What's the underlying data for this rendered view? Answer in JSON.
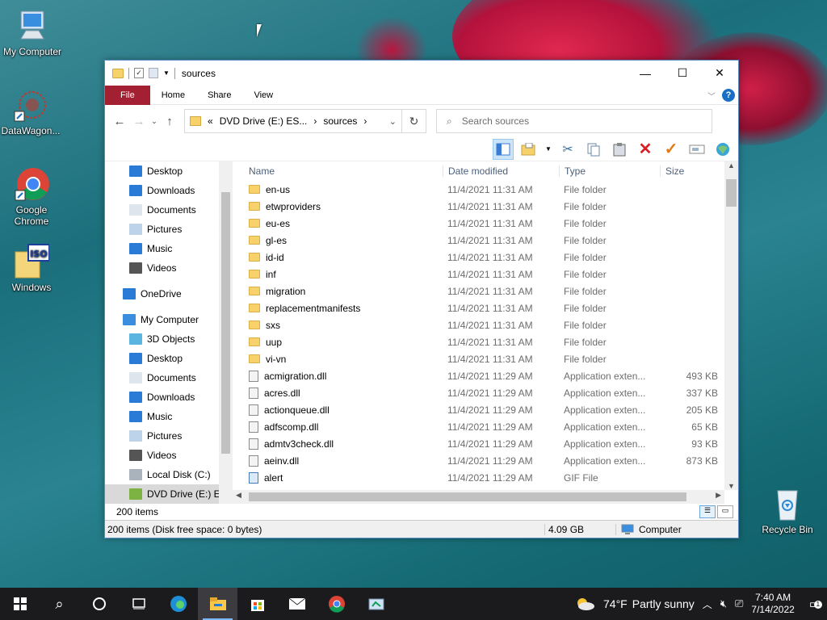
{
  "desktop": {
    "icons": [
      {
        "label": "My Computer",
        "icon": "monitor-icon"
      },
      {
        "label": "DataWagon...",
        "icon": "datawagon-icon"
      },
      {
        "label": "Google Chrome",
        "icon": "chrome-icon"
      },
      {
        "label": "Windows",
        "icon": "iso-icon"
      },
      {
        "label": "Recycle Bin",
        "icon": "recycle-bin-icon"
      }
    ]
  },
  "window": {
    "title": "sources",
    "tabs": {
      "file": "File",
      "home": "Home",
      "share": "Share",
      "view": "View"
    },
    "address": {
      "path_prefix": "«",
      "drive": "DVD Drive (E:) ES...",
      "sep": "›",
      "folder": "sources"
    },
    "search": {
      "placeholder": "Search sources"
    },
    "nav_quick": [
      {
        "label": "Desktop",
        "icon": "desktop-icon"
      },
      {
        "label": "Downloads",
        "icon": "downloads-icon"
      },
      {
        "label": "Documents",
        "icon": "documents-icon"
      },
      {
        "label": "Pictures",
        "icon": "pictures-icon"
      },
      {
        "label": "Music",
        "icon": "music-icon"
      },
      {
        "label": "Videos",
        "icon": "videos-icon"
      }
    ],
    "nav_onedrive": "OneDrive",
    "nav_mycomputer": "My Computer",
    "nav_pc": [
      {
        "label": "3D Objects",
        "icon": "3d-objects-icon"
      },
      {
        "label": "Desktop",
        "icon": "desktop-icon"
      },
      {
        "label": "Documents",
        "icon": "documents-icon"
      },
      {
        "label": "Downloads",
        "icon": "downloads-icon"
      },
      {
        "label": "Music",
        "icon": "music-icon"
      },
      {
        "label": "Pictures",
        "icon": "pictures-icon"
      },
      {
        "label": "Videos",
        "icon": "videos-icon"
      },
      {
        "label": "Local Disk (C:)",
        "icon": "local-disk-icon"
      },
      {
        "label": "DVD Drive (E:) ES",
        "icon": "dvd-drive-icon"
      }
    ],
    "columns": {
      "name": "Name",
      "date": "Date modified",
      "type": "Type",
      "size": "Size"
    },
    "files": [
      {
        "name": "en-us",
        "date": "11/4/2021 11:31 AM",
        "type": "File folder",
        "size": "",
        "kind": "folder"
      },
      {
        "name": "etwproviders",
        "date": "11/4/2021 11:31 AM",
        "type": "File folder",
        "size": "",
        "kind": "folder"
      },
      {
        "name": "eu-es",
        "date": "11/4/2021 11:31 AM",
        "type": "File folder",
        "size": "",
        "kind": "folder"
      },
      {
        "name": "gl-es",
        "date": "11/4/2021 11:31 AM",
        "type": "File folder",
        "size": "",
        "kind": "folder"
      },
      {
        "name": "id-id",
        "date": "11/4/2021 11:31 AM",
        "type": "File folder",
        "size": "",
        "kind": "folder"
      },
      {
        "name": "inf",
        "date": "11/4/2021 11:31 AM",
        "type": "File folder",
        "size": "",
        "kind": "folder"
      },
      {
        "name": "migration",
        "date": "11/4/2021 11:31 AM",
        "type": "File folder",
        "size": "",
        "kind": "folder"
      },
      {
        "name": "replacementmanifests",
        "date": "11/4/2021 11:31 AM",
        "type": "File folder",
        "size": "",
        "kind": "folder"
      },
      {
        "name": "sxs",
        "date": "11/4/2021 11:31 AM",
        "type": "File folder",
        "size": "",
        "kind": "folder"
      },
      {
        "name": "uup",
        "date": "11/4/2021 11:31 AM",
        "type": "File folder",
        "size": "",
        "kind": "folder"
      },
      {
        "name": "vi-vn",
        "date": "11/4/2021 11:31 AM",
        "type": "File folder",
        "size": "",
        "kind": "folder"
      },
      {
        "name": "acmigration.dll",
        "date": "11/4/2021 11:29 AM",
        "type": "Application exten...",
        "size": "493 KB",
        "kind": "dll"
      },
      {
        "name": "acres.dll",
        "date": "11/4/2021 11:29 AM",
        "type": "Application exten...",
        "size": "337 KB",
        "kind": "dll"
      },
      {
        "name": "actionqueue.dll",
        "date": "11/4/2021 11:29 AM",
        "type": "Application exten...",
        "size": "205 KB",
        "kind": "dll"
      },
      {
        "name": "adfscomp.dll",
        "date": "11/4/2021 11:29 AM",
        "type": "Application exten...",
        "size": "65 KB",
        "kind": "dll"
      },
      {
        "name": "admtv3check.dll",
        "date": "11/4/2021 11:29 AM",
        "type": "Application exten...",
        "size": "93 KB",
        "kind": "dll"
      },
      {
        "name": "aeinv.dll",
        "date": "11/4/2021 11:29 AM",
        "type": "Application exten...",
        "size": "873 KB",
        "kind": "dll"
      },
      {
        "name": "alert",
        "date": "11/4/2021 11:29 AM",
        "type": "GIF File",
        "size": "",
        "kind": "gif"
      }
    ],
    "status": {
      "item_count": "200 items"
    },
    "details": {
      "summary": "200 items (Disk free space: 0 bytes)",
      "size": "4.09 GB",
      "location": "Computer"
    }
  },
  "taskbar": {
    "weather": {
      "temp": "74°F",
      "desc": "Partly sunny"
    },
    "time": "7:40 AM",
    "date": "7/14/2022",
    "notification_count": "1"
  },
  "colors": {
    "file_tab": "#a32033",
    "taskbar": "#1b1b1d",
    "accent": "#1a6fc5"
  }
}
